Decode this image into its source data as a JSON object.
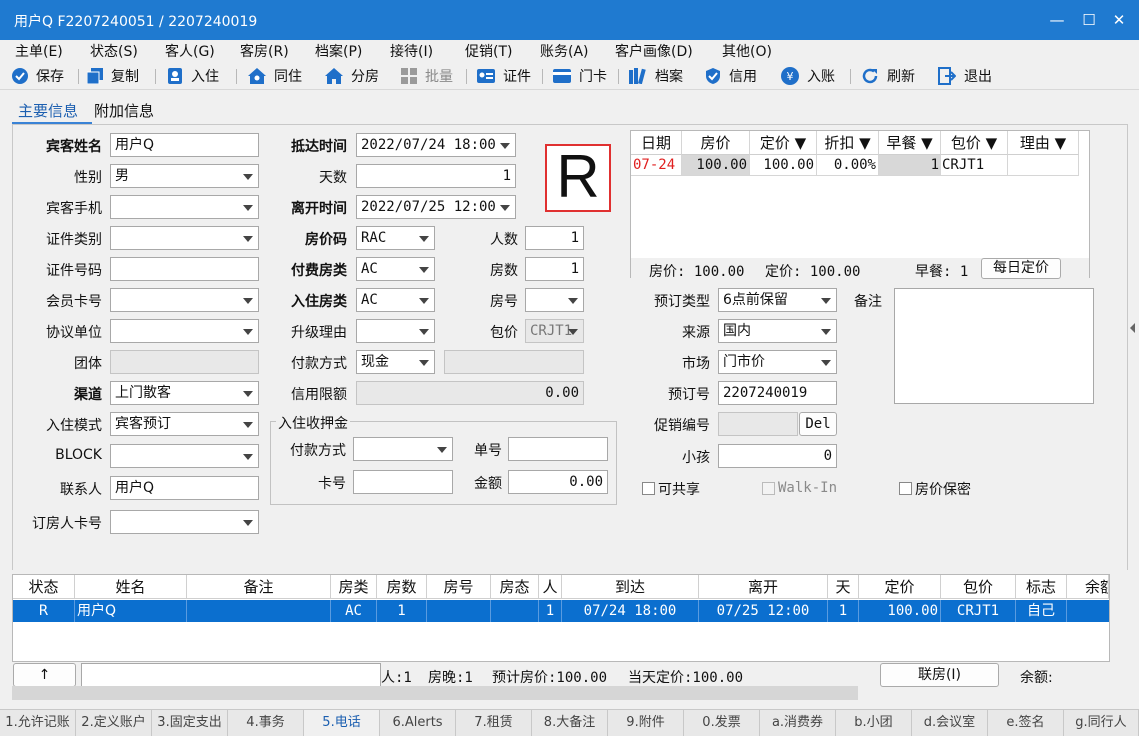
{
  "window": {
    "title": "用户Q  F2207240051 / 2207240019"
  },
  "menu": [
    "主单(E)",
    "状态(S)",
    "客人(G)",
    "客房(R)",
    "档案(P)",
    "接待(I)",
    "促销(T)",
    "账务(A)",
    "客户画像(D)",
    "其他(O)"
  ],
  "toolbar": {
    "save": "保存",
    "copy": "复制",
    "checkin": "入住",
    "share": "同住",
    "assign": "分房",
    "batch": "批量",
    "cert": "证件",
    "card": "门卡",
    "archive": "档案",
    "credit": "信用",
    "post": "入账",
    "refresh": "刷新",
    "exit": "退出"
  },
  "tabs": {
    "main": "主要信息",
    "extra": "附加信息"
  },
  "form": {
    "guest_name_label": "宾客姓名",
    "guest_name": "用户Q",
    "gender_label": "性别",
    "gender": "男",
    "mobile_label": "宾客手机",
    "mobile": "",
    "id_type_label": "证件类别",
    "id_type": "",
    "id_no_label": "证件号码",
    "id_no": "",
    "member_label": "会员卡号",
    "member": "",
    "agreement_label": "协议单位",
    "agreement": "",
    "group_label": "团体",
    "group": "",
    "channel_label": "渠道",
    "channel": "上门散客",
    "mode_label": "入住模式",
    "mode": "宾客预订",
    "block_label": "BLOCK",
    "block": "",
    "contact_label": "联系人",
    "contact": "用户Q",
    "booker_label": "订房人卡号",
    "booker": "",
    "arrival_label": "抵达时间",
    "arrival": "2022/07/24 18:00",
    "days_label": "天数",
    "days": "1",
    "depart_label": "离开时间",
    "depart": "2022/07/25 12:00",
    "rate_code_label": "房价码",
    "rate_code": "RAC",
    "persons_label": "人数",
    "persons": "1",
    "pay_room_label": "付费房类",
    "pay_room": "AC",
    "rooms_label": "房数",
    "rooms": "1",
    "stay_room_label": "入住房类",
    "stay_room": "AC",
    "room_no_label": "房号",
    "room_no": "",
    "upgrade_label": "升级理由",
    "upgrade": "",
    "package_label": "包价",
    "package": "CRJT1",
    "pay_method_label": "付款方式",
    "pay_method": "现金",
    "pay_extra": "",
    "credit_label": "信用限额",
    "credit": "0.00",
    "deposit_title": "入住收押金",
    "dep_pay_label": "付款方式",
    "dep_pay": "",
    "dep_no_label": "单号",
    "dep_no": "",
    "dep_card_label": "卡号",
    "dep_card": "",
    "dep_amount_label": "金额",
    "dep_amount": "0.00",
    "status_mark": "R",
    "booking_type_label": "预订类型",
    "booking_type": "6点前保留",
    "source_label": "来源",
    "source": "国内",
    "market_label": "市场",
    "market": "门市价",
    "booking_no_label": "预订号",
    "booking_no": "2207240019",
    "promo_label": "促销编号",
    "promo": "",
    "promo_btn": "Del",
    "child_label": "小孩",
    "child": "0",
    "remark_label": "备注",
    "remark": "",
    "shareable": "可共享",
    "walkin": "Walk-In",
    "rate_secret": "房价保密"
  },
  "rate_grid": {
    "headers": [
      "日期",
      "房价",
      "定价 ▼",
      "折扣 ▼",
      "早餐 ▼",
      "包价 ▼",
      "理由 ▼"
    ],
    "row": {
      "date": "07-24",
      "price": "100.00",
      "set": "100.00",
      "discount": "0.00%",
      "breakfast": "1",
      "package": "CRJT1",
      "reason": ""
    },
    "summary": {
      "price": "房价: 100.00",
      "set": "定价: 100.00",
      "breakfast": "早餐: 1",
      "daily_btn": "每日定价"
    }
  },
  "lower_grid": {
    "headers": [
      "状态",
      "姓名",
      "备注",
      "房类",
      "房数",
      "房号",
      "房态",
      "人",
      "到达",
      "离开",
      "天",
      "定价",
      "包价",
      "标志",
      "余额"
    ],
    "row": {
      "status": "R",
      "name": "用户Q",
      "remark": "",
      "room_type": "AC",
      "rooms": "1",
      "room_no": "",
      "room_state": "",
      "persons": "1",
      "arrive": "07/24 18:00",
      "depart": "07/25 12:00",
      "days": "1",
      "price": "100.00",
      "package": "CRJT1",
      "flag": "自己",
      "balance": ""
    }
  },
  "status": {
    "up": "↑",
    "persons": "人:1",
    "nights": "房晚:1",
    "est": "预计房价:100.00",
    "today": "当天定价:100.00",
    "link_btn": "联房(I)",
    "balance": "余额:"
  },
  "bottom_tabs": [
    "1.允许记账",
    "2.定义账户",
    "3.固定支出",
    "4.事务",
    "5.电话",
    "6.Alerts",
    "7.租赁",
    "8.大备注",
    "9.附件",
    "0.发票",
    "a.消费券",
    "b.小团",
    "d.会议室",
    "e.签名",
    "g.同行人"
  ]
}
